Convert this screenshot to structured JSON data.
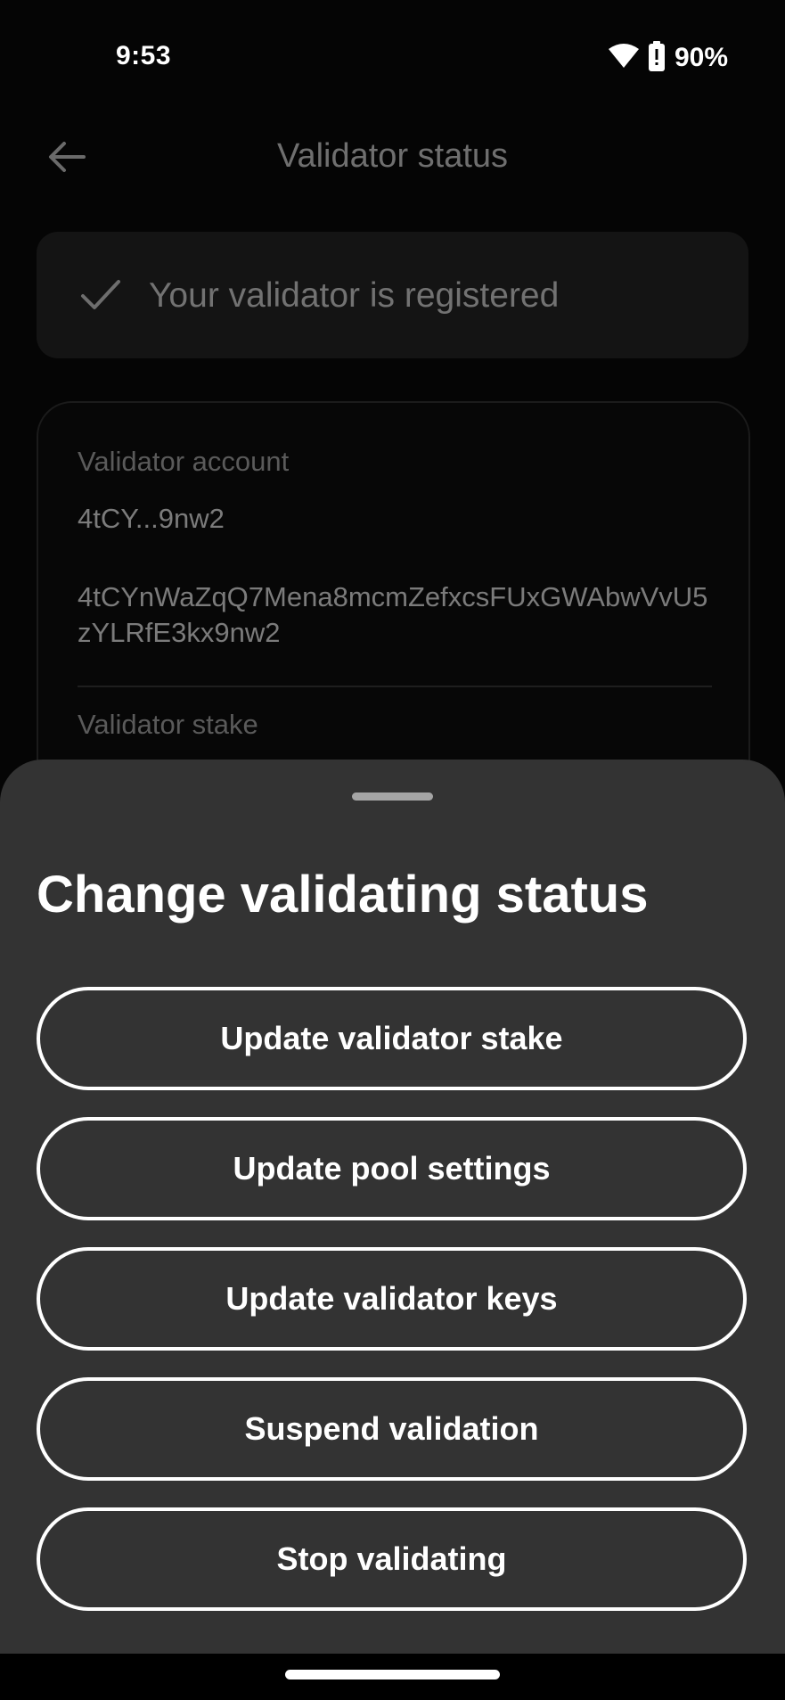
{
  "status_bar": {
    "time": "9:53",
    "battery_percent": "90%",
    "icons": [
      "wifi-icon",
      "battery-icon"
    ]
  },
  "app_bar": {
    "title": "Validator status",
    "back_icon": "arrow-left-icon"
  },
  "banner": {
    "icon": "check-icon",
    "text": "Your validator is registered"
  },
  "card": {
    "account_label": "Validator account",
    "account_short": "4tCY...9nw2",
    "account_full": "4tCYnWaZqQ7Mena8mcmZefxcsFUxGWAbwVvU5zYLRfE3kx9nw2",
    "stake_label": "Validator stake"
  },
  "sheet": {
    "title": "Change validating status",
    "buttons": [
      {
        "label": "Update validator stake"
      },
      {
        "label": "Update pool settings"
      },
      {
        "label": "Update validator keys"
      },
      {
        "label": "Suspend validation"
      },
      {
        "label": "Stop validating"
      }
    ]
  },
  "colors": {
    "background": "#050505",
    "sheet": "#333333",
    "accent_text": "#ffffff",
    "muted_text": "#727272"
  }
}
